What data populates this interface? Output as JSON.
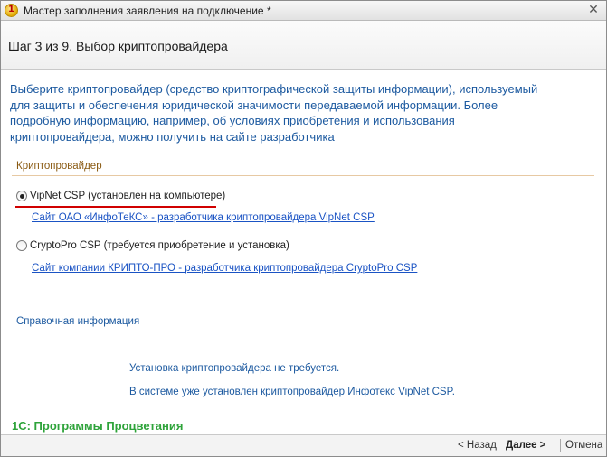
{
  "window": {
    "title": "Мастер заполнения заявления на подключение *",
    "app_icon_glyph": "1"
  },
  "header": {
    "step_title": "Шаг 3 из 9. Выбор криптопровайдера"
  },
  "description": {
    "lines": [
      "Выберите криптопровайдер (средство криптографической защиты информации), используемый",
      "для защиты и обеспечения юридической значимости передаваемой информации. Более",
      "подробную информацию, например, об условиях приобретения и использования",
      "криптопровайдера, можно получить на сайте разработчика"
    ]
  },
  "crypto_group": {
    "title": "Криптопровайдер",
    "options": [
      {
        "label": "VipNet CSP (установлен на компьютере)",
        "selected": true,
        "link": "Сайт ОАО «ИнфоТеКС» - разработчика криптопровайдера VipNet CSP"
      },
      {
        "label": "CryptoPro CSP (требуется приобретение и установка)",
        "selected": false,
        "link": "Сайт компании КРИПТО-ПРО - разработчика криптопровайдера CryptoPro CSP"
      }
    ]
  },
  "info_group": {
    "title": "Справочная информация",
    "lines": [
      "Установка криптопровайдера не требуется.",
      "В системе уже установлен криптопровайдер Инфотекс VipNet CSP."
    ]
  },
  "brand": "1С: Программы Процветания",
  "footer": {
    "back": "< Назад",
    "next": "Далее >",
    "cancel": "Отмена"
  },
  "colors": {
    "description_text": "#1d5aa0",
    "crypto_group_title": "#8a5a12",
    "info_group_title": "#1d5aa0",
    "link": "#1a53c4",
    "highlight_underline": "#d00000",
    "brand": "#2ea33a"
  },
  "icons": {
    "app": "1c-app-icon",
    "close": "close-icon"
  }
}
